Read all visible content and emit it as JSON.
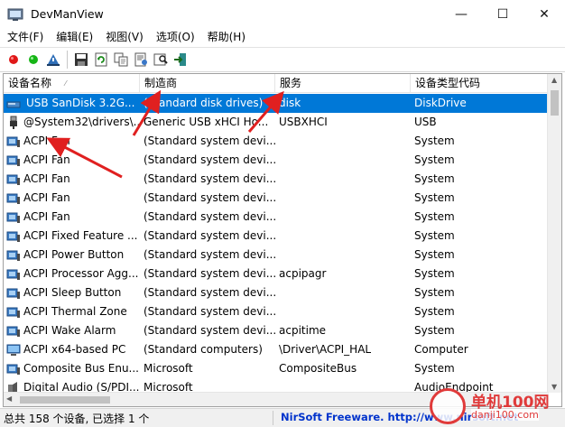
{
  "window": {
    "title": "DevManView",
    "minimize": "—",
    "maximize": "☐",
    "close": "✕"
  },
  "menu": [
    "文件(F)",
    "编辑(E)",
    "视图(V)",
    "选项(O)",
    "帮助(H)"
  ],
  "toolbar": {
    "buttons": [
      "enable-icon",
      "disable-icon",
      "properties-icon",
      "save-icon",
      "refresh-icon",
      "copy-icon",
      "html-report-icon",
      "find-icon",
      "exit-icon"
    ]
  },
  "columns": [
    "设备名称",
    "制造商",
    "服务",
    "设备类型代码"
  ],
  "rows": [
    {
      "icon": "usb-drive-icon",
      "name": "USB  SanDisk 3.2G...",
      "manufacturer": "(Standard disk drives)",
      "service": "disk",
      "type": "DiskDrive",
      "selected": true
    },
    {
      "icon": "usb-plug-icon",
      "name": "@System32\\drivers\\...",
      "manufacturer": "Generic USB xHCI Ho...",
      "service": "USBXHCI",
      "type": "USB"
    },
    {
      "icon": "system-device-icon",
      "name": "ACPI Fan",
      "manufacturer": "(Standard system devi...",
      "service": "",
      "type": "System"
    },
    {
      "icon": "system-device-icon",
      "name": "ACPI Fan",
      "manufacturer": "(Standard system devi...",
      "service": "",
      "type": "System"
    },
    {
      "icon": "system-device-icon",
      "name": "ACPI Fan",
      "manufacturer": "(Standard system devi...",
      "service": "",
      "type": "System"
    },
    {
      "icon": "system-device-icon",
      "name": "ACPI Fan",
      "manufacturer": "(Standard system devi...",
      "service": "",
      "type": "System"
    },
    {
      "icon": "system-device-icon",
      "name": "ACPI Fan",
      "manufacturer": "(Standard system devi...",
      "service": "",
      "type": "System"
    },
    {
      "icon": "system-device-icon",
      "name": "ACPI Fixed Feature ...",
      "manufacturer": "(Standard system devi...",
      "service": "",
      "type": "System"
    },
    {
      "icon": "system-device-icon",
      "name": "ACPI Power Button",
      "manufacturer": "(Standard system devi...",
      "service": "",
      "type": "System"
    },
    {
      "icon": "system-device-icon",
      "name": "ACPI Processor Agg...",
      "manufacturer": "(Standard system devi...",
      "service": "acpipagr",
      "type": "System"
    },
    {
      "icon": "system-device-icon",
      "name": "ACPI Sleep Button",
      "manufacturer": "(Standard system devi...",
      "service": "",
      "type": "System"
    },
    {
      "icon": "system-device-icon",
      "name": "ACPI Thermal Zone",
      "manufacturer": "(Standard system devi...",
      "service": "",
      "type": "System"
    },
    {
      "icon": "system-device-icon",
      "name": "ACPI Wake Alarm",
      "manufacturer": "(Standard system devi...",
      "service": "acpitime",
      "type": "System"
    },
    {
      "icon": "computer-icon",
      "name": "ACPI x64-based PC",
      "manufacturer": "(Standard computers)",
      "service": "\\Driver\\ACPI_HAL",
      "type": "Computer"
    },
    {
      "icon": "system-device-icon",
      "name": "Composite Bus Enu...",
      "manufacturer": "Microsoft",
      "service": "CompositeBus",
      "type": "System"
    },
    {
      "icon": "audio-device-icon",
      "name": "Digital Audio (S/PDI...",
      "manufacturer": "Microsoft",
      "service": "",
      "type": "AudioEndpoint"
    }
  ],
  "status": {
    "count": "总共 158 个设备, 已选择 1 个",
    "nirsoft": "NirSoft Freeware.  http://www.nirsoft.net"
  },
  "watermark": {
    "name": "单机100网",
    "url": "danji100.com"
  },
  "colors": {
    "selection": "#0078d7",
    "annotation_arrow": "#e02020"
  }
}
